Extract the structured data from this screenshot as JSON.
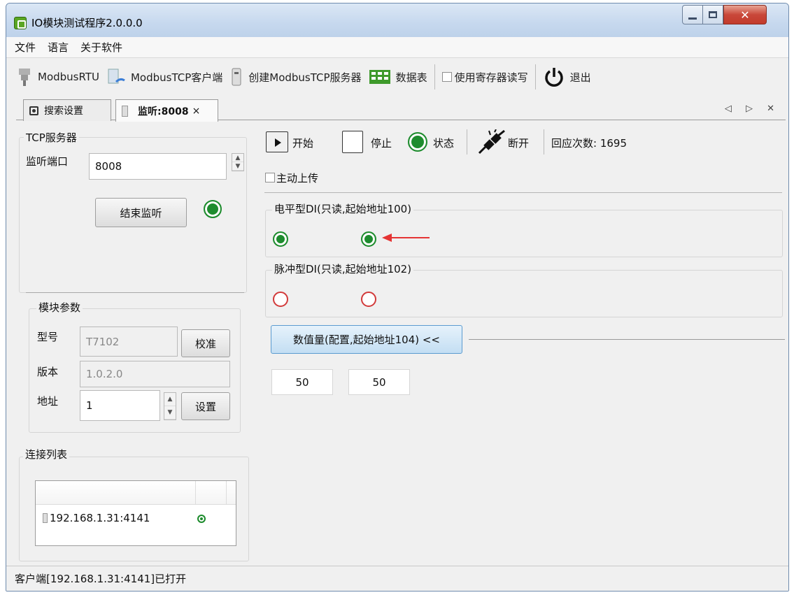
{
  "window": {
    "title": "IO模块测试程序2.0.0.0"
  },
  "menu": [
    "文件",
    "语言",
    "关于软件"
  ],
  "toolbar": {
    "rtu": "ModbusRTU",
    "tcp_client": "ModbusTCP客户端",
    "tcp_server": "创建ModbusTCP服务器",
    "data_table": "数据表",
    "register_rw": "使用寄存器读写",
    "exit": "退出"
  },
  "tabs": {
    "search": "搜索设置",
    "listen": "监听:8008",
    "close": "×",
    "arrows": "◁ ▷ ✕"
  },
  "left": {
    "tcp_server_label": "TCP服务器",
    "listen_port_label": "监听端口",
    "listen_port_value": "8008",
    "stop_listen": "结束监听",
    "module_params_label": "模块参数",
    "model_label": "型号",
    "model_value": "T7102",
    "calibrate": "校准",
    "version_label": "版本",
    "version_value": "1.0.2.0",
    "address_label": "地址",
    "address_value": "1",
    "set": "设置",
    "conn_list_label": "连接列表",
    "conn_entry": "192.168.1.31:4141"
  },
  "right": {
    "start": "开始",
    "stop": "停止",
    "status": "状态",
    "disconnect": "断开",
    "response_count": "回应次数: 1695",
    "auto_upload": "主动上传",
    "di_level_label": "电平型DI(只读,起始地址100)",
    "di_pulse_label": "脉冲型DI(只读,起始地址102)",
    "numeric_button": "数值量(配置,起始地址104) <<",
    "values": [
      "50",
      "50"
    ]
  },
  "status_text": "客户端[192.168.1.31:4141]已打开"
}
